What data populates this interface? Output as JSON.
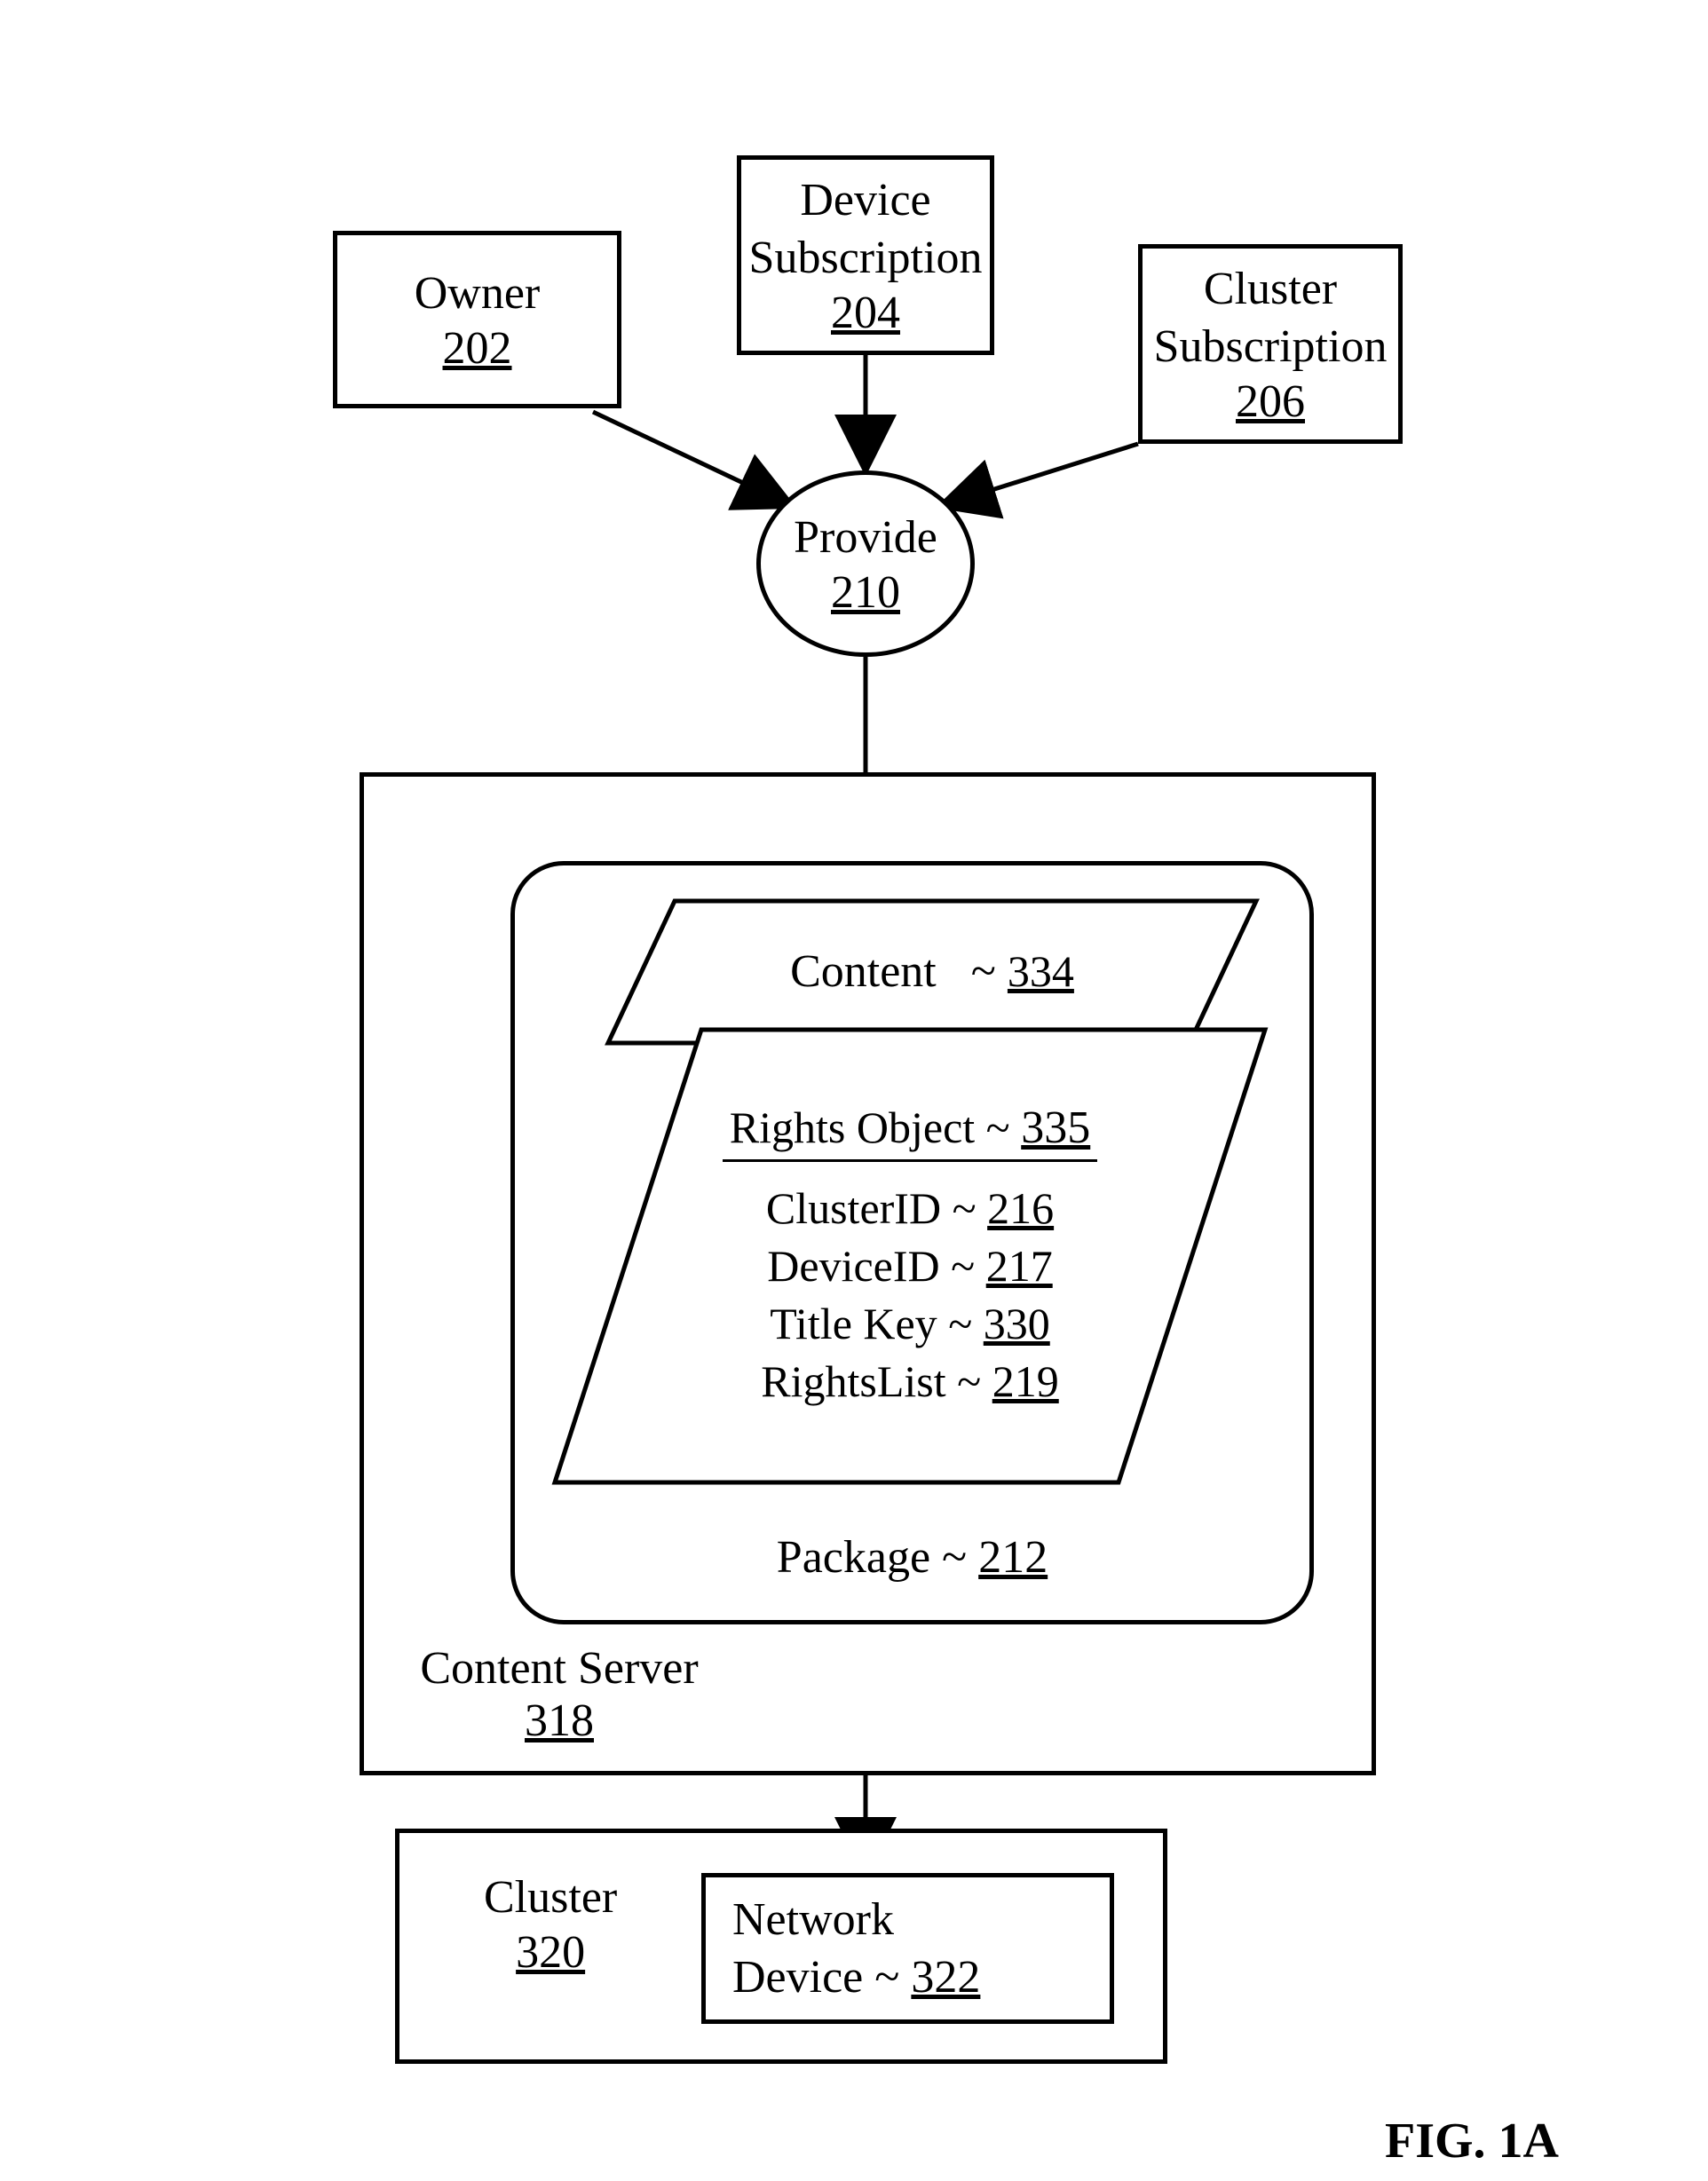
{
  "figure_caption": "FIG. 1A",
  "owner": {
    "label": "Owner",
    "ref": "202"
  },
  "device_subscription": {
    "label": "Device\nSubscription",
    "ref": "204"
  },
  "cluster_subscription": {
    "label": "Cluster\nSubscription",
    "ref": "206"
  },
  "provide": {
    "label": "Provide",
    "ref": "210"
  },
  "content_server": {
    "label": "Content Server",
    "ref": "318"
  },
  "package": {
    "label": "Package",
    "ref": "212"
  },
  "content": {
    "label": "Content",
    "ref": "334"
  },
  "rights_object": {
    "title": "Rights Object",
    "ref": "335",
    "fields": {
      "cluster_id": {
        "label": "ClusterID",
        "ref": "216"
      },
      "device_id": {
        "label": "DeviceID",
        "ref": "217"
      },
      "title_key": {
        "label": "Title Key",
        "ref": "330"
      },
      "rights_list": {
        "label": "RightsList",
        "ref": "219"
      }
    }
  },
  "cluster": {
    "label": "Cluster",
    "ref": "320"
  },
  "network_device": {
    "label": "Network\nDevice",
    "ref": "322"
  }
}
